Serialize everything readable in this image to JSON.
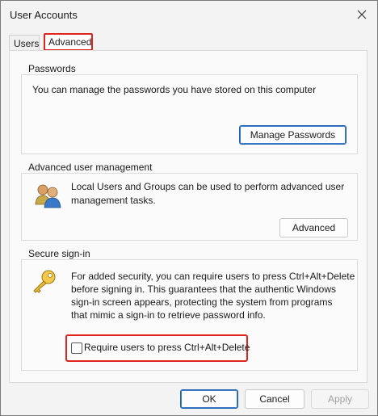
{
  "window": {
    "title": "User Accounts",
    "close_icon": "close-icon"
  },
  "tabs": [
    {
      "label": "Users",
      "active": false
    },
    {
      "label": "Advanced",
      "active": true
    }
  ],
  "passwords": {
    "heading": "Passwords",
    "description": "You can manage the passwords you have stored on this computer",
    "button_label": "Manage Passwords"
  },
  "advanced_management": {
    "heading": "Advanced user management",
    "icon": "users-icon",
    "description_line1": "Local Users and Groups can be used to perform advanced user",
    "description_line2": "management tasks.",
    "button_label": "Advanced"
  },
  "secure_signin": {
    "heading": "Secure sign-in",
    "icon": "key-icon",
    "description_line1": "For added security, you can require users to press Ctrl+Alt+Delete",
    "description_line2": "before signing in. This guarantees that the authentic Windows",
    "description_line3": "sign-in screen appears, protecting the system from programs",
    "description_line4": "that mimic a sign-in to retrieve password info.",
    "checkbox_label": "Require users to press Ctrl+Alt+Delete",
    "checkbox_checked": false
  },
  "footer": {
    "ok_label": "OK",
    "cancel_label": "Cancel",
    "apply_label": "Apply"
  },
  "colors": {
    "highlight": "#e0241c",
    "accent": "#1f5fa8"
  }
}
